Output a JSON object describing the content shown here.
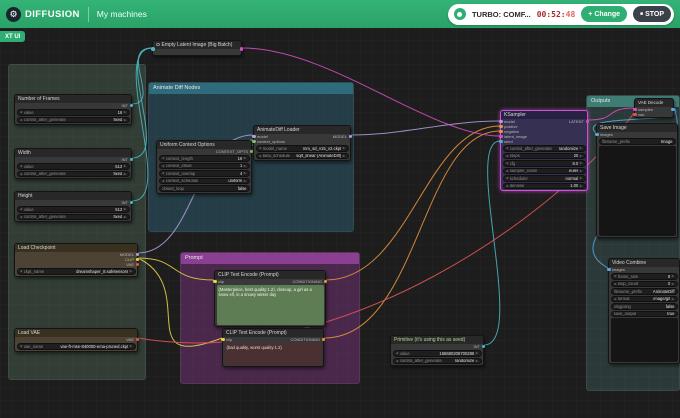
{
  "header": {
    "logo_text": "DIFFUSION",
    "nav_item": "My machines",
    "machine_label": "TURBO: COMF...",
    "timer_hm": "00:52:",
    "timer_sec": "48",
    "change_icon": "+",
    "change_label": "Change",
    "stop_icon": "■",
    "stop_label": "STOP"
  },
  "canvas": {
    "ui_toggle_label": "XT UI",
    "groups": {
      "inputs": {
        "title": ""
      },
      "animatediff": {
        "title": "Animate Diff Nodes"
      },
      "prompt": {
        "title": "Prompt"
      },
      "outputs": {
        "title": "Outputs"
      }
    },
    "nodes": {
      "empty_latent": {
        "title": "Empty Latent Image (Big Batch)"
      },
      "frames": {
        "title": "Number of Frames",
        "output": "INT",
        "widgets": [
          {
            "label": "value",
            "value": "16"
          },
          {
            "label": "control_after_generate",
            "value": "fixed"
          }
        ]
      },
      "width": {
        "title": "Width",
        "output": "INT",
        "widgets": [
          {
            "label": "value",
            "value": "512"
          },
          {
            "label": "control_after_generate",
            "value": "fixed"
          }
        ]
      },
      "height": {
        "title": "Height",
        "output": "INT",
        "widgets": [
          {
            "label": "value",
            "value": "512"
          },
          {
            "label": "control_after_generate",
            "value": "fixed"
          }
        ]
      },
      "checkpoint": {
        "title": "Load Checkpoint",
        "outputs": [
          "MODEL",
          "CLIP",
          "VAE"
        ],
        "widgets": [
          {
            "label": "ckpt_name",
            "value": "dreamshaper_8.safetensors"
          }
        ]
      },
      "vae_loader": {
        "title": "Load VAE",
        "output": "VAE",
        "widgets": [
          {
            "label": "vae_name",
            "value": "vae-ft-mse-840000-ema-pruned.ckpt"
          }
        ]
      },
      "context_options": {
        "title": "Uniform Context Options",
        "output": "CONTEXT_OPTS",
        "widgets": [
          {
            "label": "context_length",
            "value": "16"
          },
          {
            "label": "context_stride",
            "value": "1"
          },
          {
            "label": "context_overlap",
            "value": "4"
          },
          {
            "label": "context_schedule",
            "value": "uniform"
          },
          {
            "label": "closed_loop",
            "value": "false"
          }
        ]
      },
      "ad_loader": {
        "title": "AnimateDiff Loader",
        "inputs": [
          "model",
          "context_options"
        ],
        "output": "MODEL",
        "widgets": [
          {
            "label": "model_name",
            "value": "mm_sd_v15_v2.ckpt"
          },
          {
            "label": "beta_schedule",
            "value": "sqrt_linear (AnimateDiff)"
          }
        ]
      },
      "positive": {
        "title": "CLIP Text Encode (Prompt)",
        "input": "clip",
        "output": "CONDITIONING",
        "text": "(Masterpiece, best quality:1.2), closeup, a girl as a snow elf, in a snowy winter day"
      },
      "negative": {
        "title": "CLIP Text Encode (Prompt)",
        "input": "clip",
        "output": "CONDITIONING",
        "text": "(bad quality, worst quality:1.2)"
      },
      "ksampler": {
        "title": "KSampler",
        "inputs": [
          "model",
          "positive",
          "negative",
          "latent_image",
          "seed"
        ],
        "output": "LATENT",
        "widgets": [
          {
            "label": "control_after_generate",
            "value": "randomize"
          },
          {
            "label": "steps",
            "value": "20"
          },
          {
            "label": "cfg",
            "value": "8.0"
          },
          {
            "label": "sampler_name",
            "value": "euler"
          },
          {
            "label": "scheduler",
            "value": "normal"
          },
          {
            "label": "denoise",
            "value": "1.00"
          }
        ]
      },
      "primitive": {
        "title": "Primitive (it's using this as seed)",
        "output": "INT",
        "widgets": [
          {
            "label": "value",
            "value": "156680208700286"
          },
          {
            "label": "control_after_generate",
            "value": "randomize"
          }
        ]
      },
      "vae_decode": {
        "title": "VAE Decode",
        "inputs": [
          "samples",
          "vae"
        ],
        "output": "IMAGE"
      },
      "save_image": {
        "title": "Save Image",
        "input": "images",
        "widgets": [
          {
            "label": "filename_prefix",
            "value": "Image"
          }
        ]
      },
      "video_combine": {
        "title": "Video Combine",
        "input": "images",
        "widgets": [
          {
            "label": "frame_rate",
            "value": "8"
          },
          {
            "label": "loop_count",
            "value": "0"
          },
          {
            "label": "filename_prefix",
            "value": "AnimateDiff"
          },
          {
            "label": "format",
            "value": "image/gif"
          },
          {
            "label": "pingpong",
            "value": "false"
          },
          {
            "label": "save_output",
            "value": "true"
          }
        ]
      }
    }
  },
  "colors": {
    "header_green": "#2fae73",
    "timer_red": "#d9534f",
    "selection_purple": "#cf52d8",
    "link_model": "#b39ddb",
    "link_clip": "#e8d44a",
    "link_vae": "#e05555",
    "link_conditioning": "#e8963c",
    "link_latent": "#d94fc0",
    "link_image": "#5aa7e0",
    "link_int": "#4ab7c3",
    "link_context": "#7fbf5f"
  }
}
